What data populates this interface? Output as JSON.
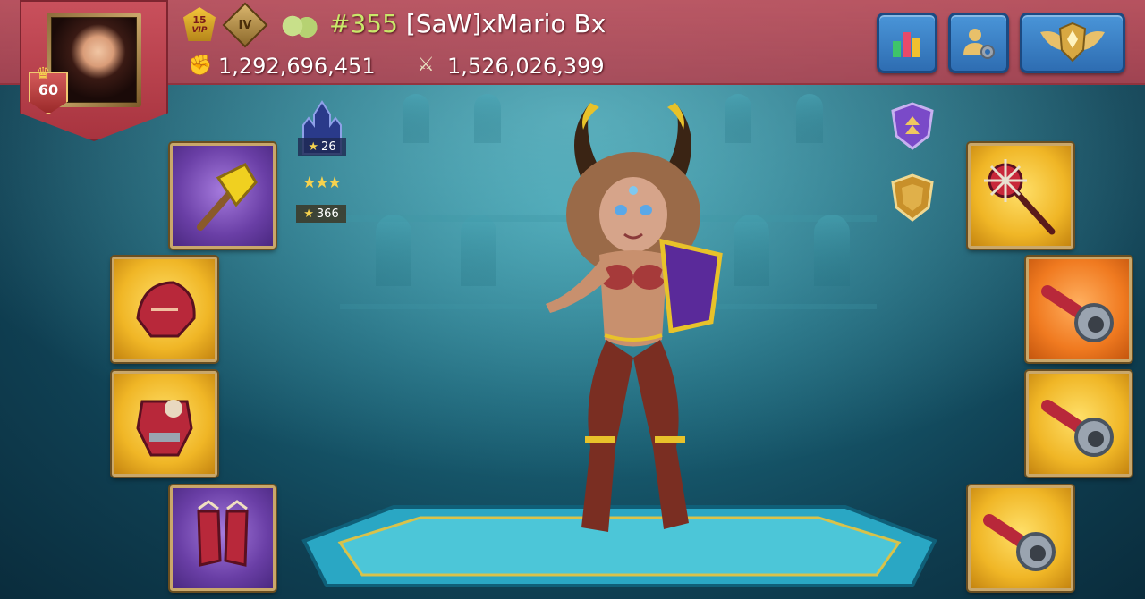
{
  "player": {
    "level": "60",
    "vip": "15",
    "vip_label": "VIP",
    "rank": "IV",
    "guild_rank": "#355",
    "name": "[SaW]xMario Bx",
    "power": "1,292,696,451",
    "kills": "1,526,026,399"
  },
  "side_stats": {
    "castle_stars": "26",
    "star_total": "366"
  },
  "equipment": {
    "left": [
      {
        "slot": "weapon",
        "icon": "golden-hammer-icon",
        "rarity": "purple"
      },
      {
        "slot": "helmet",
        "icon": "dragon-helmet-icon",
        "rarity": "gold"
      },
      {
        "slot": "armor",
        "icon": "chest-armor-icon",
        "rarity": "gold"
      },
      {
        "slot": "boots",
        "icon": "spiked-boots-icon",
        "rarity": "purple"
      }
    ],
    "right": [
      {
        "slot": "off-hand",
        "icon": "spiked-mace-icon",
        "rarity": "gold"
      },
      {
        "slot": "accessory-1",
        "icon": "cannon-icon",
        "rarity": "orange"
      },
      {
        "slot": "accessory-2",
        "icon": "cannon-icon",
        "rarity": "gold"
      },
      {
        "slot": "accessory-3",
        "icon": "cannon-icon",
        "rarity": "gold"
      }
    ]
  },
  "colors": {
    "topbar": "#c4545f",
    "button_blue": "#2e6db2",
    "gold": "#f0b626",
    "purple": "#6a3fa6",
    "guild_green": "#c9e86a"
  }
}
